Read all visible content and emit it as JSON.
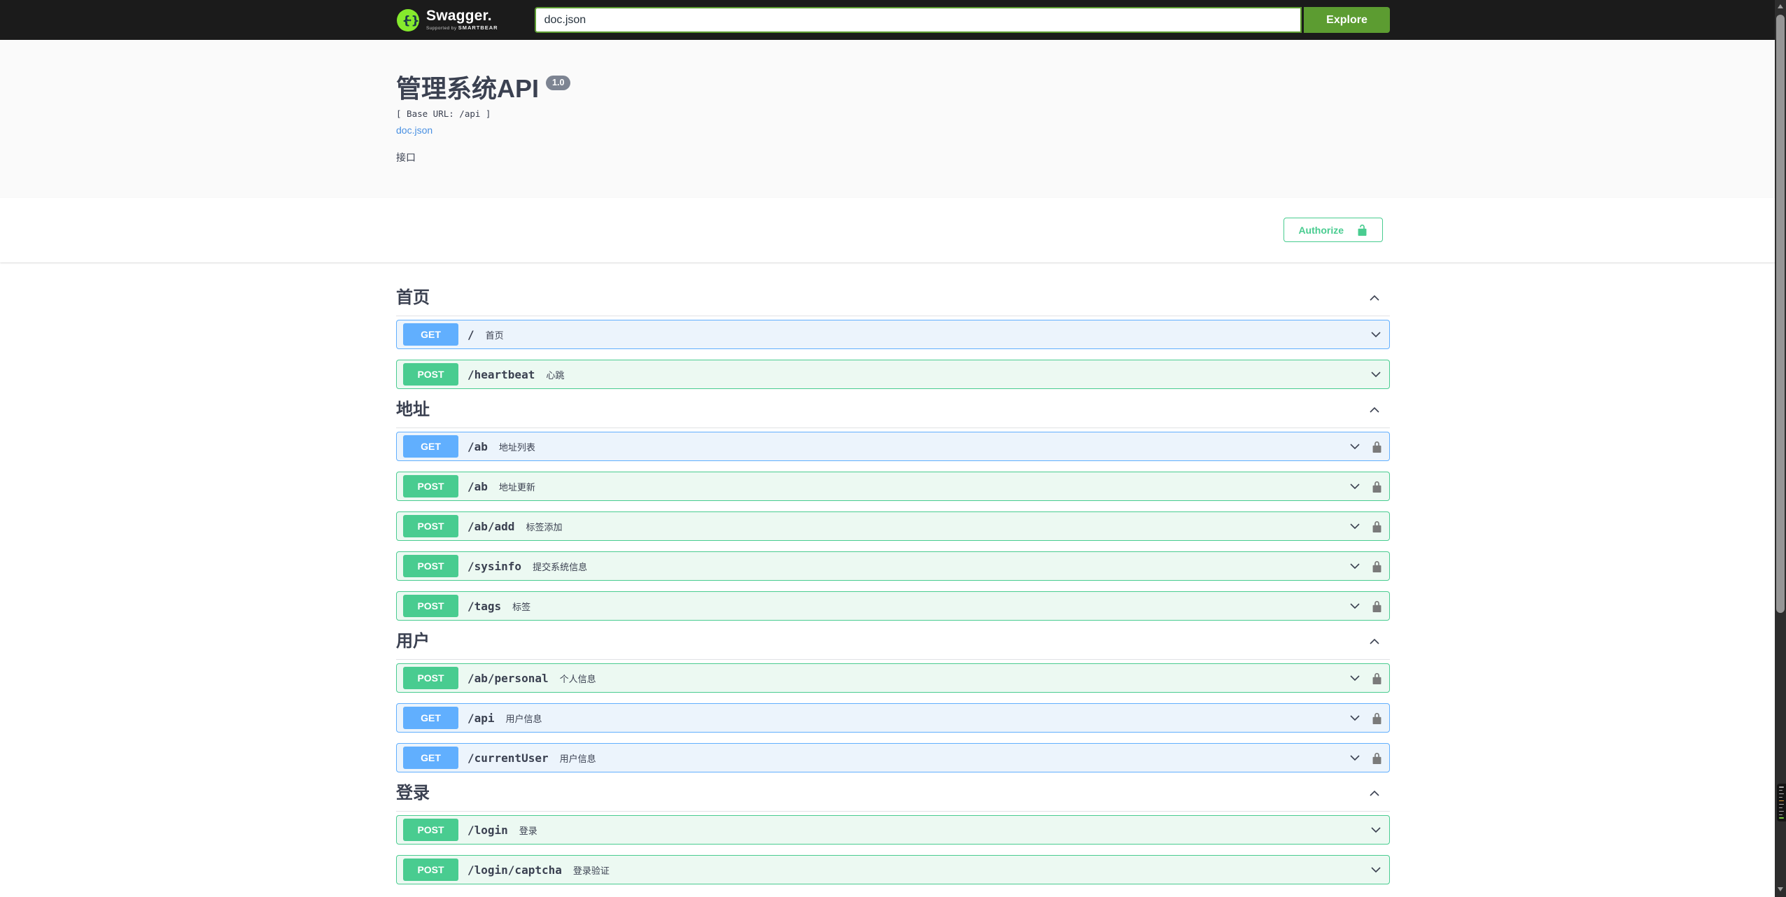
{
  "topbar": {
    "brand": "Swagger.",
    "brand_sub_prefix": "Supported by ",
    "brand_sub_company": "SMARTBEAR",
    "search_value": "doc.json",
    "explore_label": "Explore"
  },
  "info": {
    "title": "管理系统API",
    "version": "1.0",
    "base_url_label": "[ Base URL: /api ]",
    "spec_link": "doc.json",
    "description": "接口"
  },
  "auth": {
    "authorize_label": "Authorize"
  },
  "icons": {
    "brand_logo": "swagger-logo (green circle with curly braces)",
    "authorize": "unlock-icon",
    "operation_expand": "chevron-down-icon",
    "section_collapse": "chevron-up-icon",
    "secured": "lock-icon",
    "scroll_up": "triangle-up",
    "scroll_down": "triangle-down"
  },
  "colors": {
    "topbar_bg": "#1b1b1b",
    "explore_green": "#5c9c31",
    "get_blue": "#61affe",
    "post_green": "#49cc90",
    "authorize_green": "#49cc90",
    "link_blue": "#4990e2",
    "text": "#3b4151",
    "version_badge_bg": "#7d8492",
    "hero_bg": "#fafafa"
  },
  "sections": [
    {
      "title": "首页",
      "operations": [
        {
          "method": "GET",
          "path": "/",
          "summary": "首页",
          "locked": false
        },
        {
          "method": "POST",
          "path": "/heartbeat",
          "summary": "心跳",
          "locked": false
        }
      ]
    },
    {
      "title": "地址",
      "operations": [
        {
          "method": "GET",
          "path": "/ab",
          "summary": "地址列表",
          "locked": true
        },
        {
          "method": "POST",
          "path": "/ab",
          "summary": "地址更新",
          "locked": true
        },
        {
          "method": "POST",
          "path": "/ab/add",
          "summary": "标签添加",
          "locked": true
        },
        {
          "method": "POST",
          "path": "/sysinfo",
          "summary": "提交系统信息",
          "locked": true
        },
        {
          "method": "POST",
          "path": "/tags",
          "summary": "标签",
          "locked": true
        }
      ]
    },
    {
      "title": "用户",
      "operations": [
        {
          "method": "POST",
          "path": "/ab/personal",
          "summary": "个人信息",
          "locked": true
        },
        {
          "method": "GET",
          "path": "/api",
          "summary": "用户信息",
          "locked": true
        },
        {
          "method": "GET",
          "path": "/currentUser",
          "summary": "用户信息",
          "locked": true
        }
      ]
    },
    {
      "title": "登录",
      "operations": [
        {
          "method": "POST",
          "path": "/login",
          "summary": "登录",
          "locked": false
        },
        {
          "method": "POST",
          "path": "/login/captcha",
          "summary": "登录验证",
          "locked": false
        }
      ]
    }
  ]
}
